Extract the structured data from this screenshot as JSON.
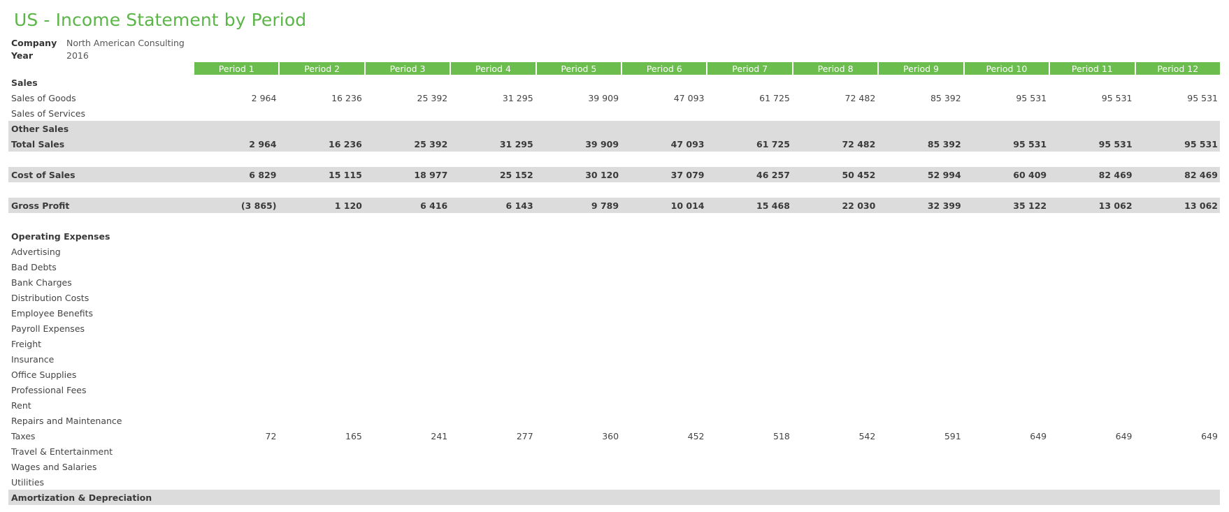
{
  "report": {
    "title": "US - Income Statement by Period",
    "company_label": "Company",
    "company_value": "North American Consulting",
    "year_label": "Year",
    "year_value": "2016"
  },
  "colors": {
    "accent": "#6bbd4e",
    "title": "#5bb548",
    "shade": "#dcdcdc",
    "negative": "#e0001b"
  },
  "periods": [
    "Period 1",
    "Period 2",
    "Period 3",
    "Period 4",
    "Period 5",
    "Period 6",
    "Period 7",
    "Period 8",
    "Period 9",
    "Period 10",
    "Period 11",
    "Period 12"
  ],
  "rows": [
    {
      "label": "Sales",
      "bold": true,
      "shade": false,
      "values": []
    },
    {
      "label": "Sales of Goods",
      "bold": false,
      "shade": false,
      "values": [
        "2 964",
        "16 236",
        "25 392",
        "31 295",
        "39 909",
        "47 093",
        "61 725",
        "72 482",
        "85 392",
        "95 531",
        "95 531",
        "95 531"
      ]
    },
    {
      "label": "Sales of Services",
      "bold": false,
      "shade": false,
      "values": []
    },
    {
      "label": "Other Sales",
      "bold": true,
      "shade": true,
      "values": []
    },
    {
      "label": "Total Sales",
      "bold": true,
      "shade": true,
      "values": [
        "2 964",
        "16 236",
        "25 392",
        "31 295",
        "39 909",
        "47 093",
        "61 725",
        "72 482",
        "85 392",
        "95 531",
        "95 531",
        "95 531"
      ]
    },
    {
      "label": "",
      "spacer": true,
      "values": []
    },
    {
      "label": "Cost of Sales",
      "bold": true,
      "shade": true,
      "values": [
        "6 829",
        "15 115",
        "18 977",
        "25 152",
        "30 120",
        "37 079",
        "46 257",
        "50 452",
        "52 994",
        "60 409",
        "82 469",
        "82 469"
      ]
    },
    {
      "label": "",
      "spacer": true,
      "values": []
    },
    {
      "label": "Gross Profit",
      "bold": true,
      "shade": true,
      "values": [
        "(3 865)",
        "1 120",
        "6 416",
        "6 143",
        "9 789",
        "10 014",
        "15 468",
        "22 030",
        "32 399",
        "35 122",
        "13 062",
        "13 062"
      ]
    },
    {
      "label": "",
      "spacer": true,
      "values": []
    },
    {
      "label": "Operating Expenses",
      "bold": true,
      "shade": false,
      "values": []
    },
    {
      "label": "Advertising",
      "bold": false,
      "shade": false,
      "values": []
    },
    {
      "label": "Bad Debts",
      "bold": false,
      "shade": false,
      "values": []
    },
    {
      "label": "Bank Charges",
      "bold": false,
      "shade": false,
      "values": []
    },
    {
      "label": "Distribution Costs",
      "bold": false,
      "shade": false,
      "values": []
    },
    {
      "label": "Employee Benefits",
      "bold": false,
      "shade": false,
      "values": []
    },
    {
      "label": "Payroll Expenses",
      "bold": false,
      "shade": false,
      "values": []
    },
    {
      "label": "Freight",
      "bold": false,
      "shade": false,
      "values": []
    },
    {
      "label": "Insurance",
      "bold": false,
      "shade": false,
      "values": []
    },
    {
      "label": "Office Supplies",
      "bold": false,
      "shade": false,
      "values": []
    },
    {
      "label": "Professional Fees",
      "bold": false,
      "shade": false,
      "values": []
    },
    {
      "label": "Rent",
      "bold": false,
      "shade": false,
      "values": []
    },
    {
      "label": "Repairs and Maintenance",
      "bold": false,
      "shade": false,
      "values": []
    },
    {
      "label": "Taxes",
      "bold": false,
      "shade": false,
      "values": [
        "72",
        "165",
        "241",
        "277",
        "360",
        "452",
        "518",
        "542",
        "591",
        "649",
        "649",
        "649"
      ]
    },
    {
      "label": "Travel & Entertainment",
      "bold": false,
      "shade": false,
      "values": []
    },
    {
      "label": "Wages and Salaries",
      "bold": false,
      "shade": false,
      "values": []
    },
    {
      "label": "Utilities",
      "bold": false,
      "shade": false,
      "values": []
    },
    {
      "label": "Amortization & Depreciation",
      "bold": true,
      "shade": true,
      "values": []
    }
  ]
}
